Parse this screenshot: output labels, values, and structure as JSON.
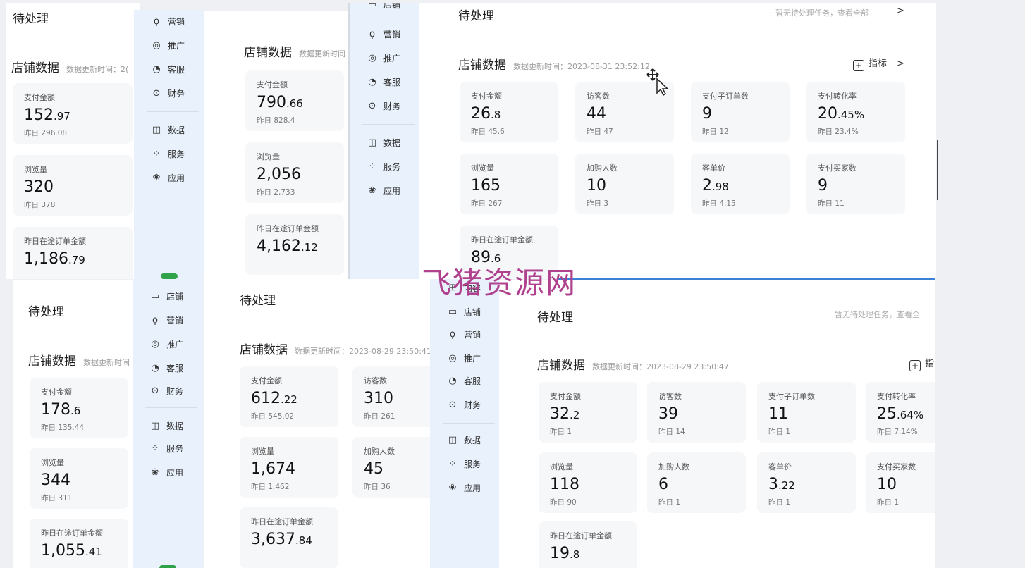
{
  "common": {
    "pending": "待处理",
    "store_data": "店铺数据",
    "update_prefix": "数据更新时间：",
    "update_prefix_trunc": "数据更新时间：2(",
    "update_prefix_trunc2": "数据更新时间",
    "update_prefix_trunc3": "数据更新时间",
    "no_task_full": "暂无待处理任务，查看全部",
    "no_task_br": "暂无待处理任务，查看全",
    "metric_label": "指标",
    "metric_label_trunc": "指",
    "chevron": ">"
  },
  "side": {
    "store": "店铺",
    "marketing": "营销",
    "promote": "推广",
    "service_cs": "客服",
    "finance": "财务",
    "data": "数据",
    "services": "服务",
    "apps": "应用",
    "content": "内容"
  },
  "icons": {
    "store": "▭",
    "marketing": "ϙ",
    "promote": "◎",
    "service_cs": "◔",
    "finance": "⊙",
    "data": "◫",
    "services": "⁘",
    "apps": "❀",
    "content": "⊞"
  },
  "panels": {
    "tl": {
      "cards": [
        {
          "label": "支付金额",
          "int": "152",
          "dec": ".97",
          "prev": "昨日 296.08"
        },
        {
          "label": "浏览量",
          "int": "320",
          "dec": "",
          "prev": "昨日 378"
        },
        {
          "label": "昨日在途订单金额",
          "int": "1,186",
          "dec": ".79",
          "prev": ""
        }
      ]
    },
    "tm": {
      "cards": [
        {
          "label": "支付金额",
          "int": "790",
          "dec": ".66",
          "prev": "昨日 828.4"
        },
        {
          "label": "浏览量",
          "int": "2,056",
          "dec": "",
          "prev": "昨日 2,733"
        },
        {
          "label": "昨日在途订单金额",
          "int": "4,162",
          "dec": ".12",
          "prev": ""
        }
      ]
    },
    "tr": {
      "time": "2023-08-31 23:52:12",
      "cards": [
        {
          "label": "支付金额",
          "int": "26",
          "dec": ".8",
          "prev": "昨日 45.6"
        },
        {
          "label": "访客数",
          "int": "44",
          "dec": "",
          "prev": "昨日 47"
        },
        {
          "label": "支付子订单数",
          "int": "9",
          "dec": "",
          "prev": "昨日 12"
        },
        {
          "label": "支付转化率",
          "int": "20",
          "dec": ".45%",
          "prev": "昨日 23.4%"
        },
        {
          "label": "浏览量",
          "int": "165",
          "dec": "",
          "prev": "昨日 267"
        },
        {
          "label": "加购人数",
          "int": "10",
          "dec": "",
          "prev": "昨日 3"
        },
        {
          "label": "客单价",
          "int": "2",
          "dec": ".98",
          "prev": "昨日 4.15"
        },
        {
          "label": "支付买家数",
          "int": "9",
          "dec": "",
          "prev": "昨日 11"
        },
        {
          "label": "昨日在途订单金额",
          "int": "89",
          "dec": ".6",
          "prev": ""
        }
      ]
    },
    "bl": {
      "cards": [
        {
          "label": "支付金额",
          "int": "178",
          "dec": ".6",
          "prev": "昨日 135.44"
        },
        {
          "label": "浏览量",
          "int": "344",
          "dec": "",
          "prev": "昨日 311"
        },
        {
          "label": "昨日在途订单金额",
          "int": "1,055",
          "dec": ".41",
          "prev": ""
        }
      ]
    },
    "bm": {
      "time": "2023-08-29 23:50:41",
      "cards": [
        {
          "label": "支付金额",
          "int": "612",
          "dec": ".22",
          "prev": "昨日 545.02"
        },
        {
          "label": "访客数",
          "int": "310",
          "dec": "",
          "prev": "昨日 261"
        },
        {
          "label": "浏览量",
          "int": "1,674",
          "dec": "",
          "prev": "昨日 1,462"
        },
        {
          "label": "加购人数",
          "int": "45",
          "dec": "",
          "prev": "昨日 36"
        },
        {
          "label": "昨日在途订单金额",
          "int": "3,637",
          "dec": ".84",
          "prev": ""
        }
      ]
    },
    "br": {
      "time": "2023-08-29 23:50:47",
      "cards": [
        {
          "label": "支付金额",
          "int": "32",
          "dec": ".2",
          "prev": "昨日 1"
        },
        {
          "label": "访客数",
          "int": "39",
          "dec": "",
          "prev": "昨日 14"
        },
        {
          "label": "支付子订单数",
          "int": "11",
          "dec": "",
          "prev": "昨日 1"
        },
        {
          "label": "支付转化率",
          "int": "25",
          "dec": ".64%",
          "prev": "昨日 7.14%"
        },
        {
          "label": "浏览量",
          "int": "118",
          "dec": "",
          "prev": "昨日 90"
        },
        {
          "label": "加购人数",
          "int": "6",
          "dec": "",
          "prev": "昨日 1"
        },
        {
          "label": "客单价",
          "int": "3",
          "dec": ".22",
          "prev": "昨日 1"
        },
        {
          "label": "支付买家数",
          "int": "10",
          "dec": "",
          "prev": "昨日 1"
        },
        {
          "label": "昨日在途订单金额",
          "int": "19",
          "dec": ".8",
          "prev": ""
        }
      ]
    }
  },
  "watermark": "飞猪资源网"
}
